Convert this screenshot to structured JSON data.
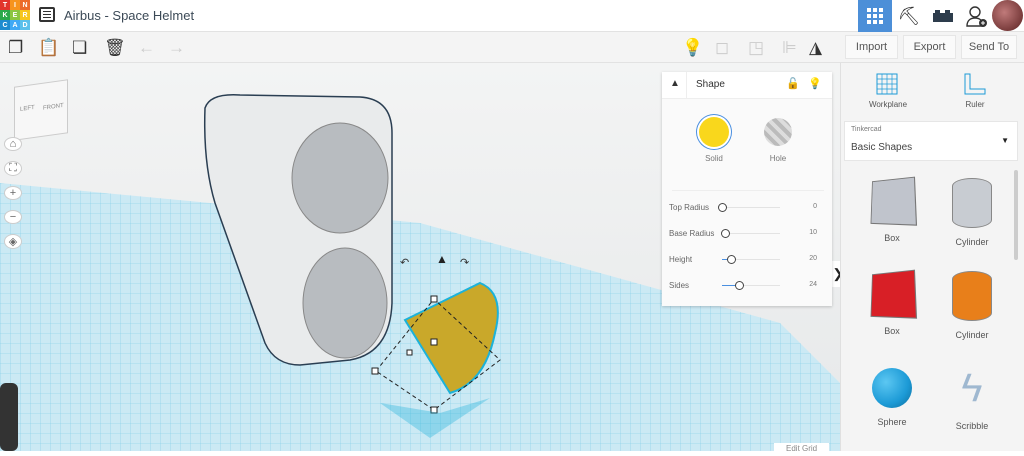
{
  "app": {
    "logo_letters": [
      "T",
      "I",
      "N",
      "K",
      "E",
      "R",
      "C",
      "A",
      "D"
    ],
    "title": "Airbus - Space Helmet"
  },
  "toolbar": {
    "import": "Import",
    "export": "Export",
    "send_to": "Send To"
  },
  "viewcube": {
    "left": "LEFT",
    "front": "FRONT"
  },
  "shape_panel": {
    "title": "Shape",
    "solid": "Solid",
    "hole": "Hole",
    "params": [
      {
        "label": "Top Radius",
        "value": "0",
        "fraction": 0
      },
      {
        "label": "Base Radius",
        "value": "10",
        "fraction": 0.05
      },
      {
        "label": "Height",
        "value": "20",
        "fraction": 0.15
      },
      {
        "label": "Sides",
        "value": "24",
        "fraction": 0.3
      }
    ]
  },
  "right_panel": {
    "workplane": "Workplane",
    "ruler": "Ruler",
    "library_category": "Tinkercad",
    "library_value": "Basic Shapes",
    "shapes": [
      {
        "label": "Box",
        "color": "#c0c4cc"
      },
      {
        "label": "Cylinder",
        "color": "#c8ccd2"
      },
      {
        "label": "Box",
        "color": "#d81f26"
      },
      {
        "label": "Cylinder",
        "color": "#e87f1a"
      },
      {
        "label": "Sphere",
        "color": "#1c9ad6"
      },
      {
        "label": "Scribble",
        "color": "#9fb8d0"
      }
    ]
  },
  "edit_grid": "Edit Grid"
}
